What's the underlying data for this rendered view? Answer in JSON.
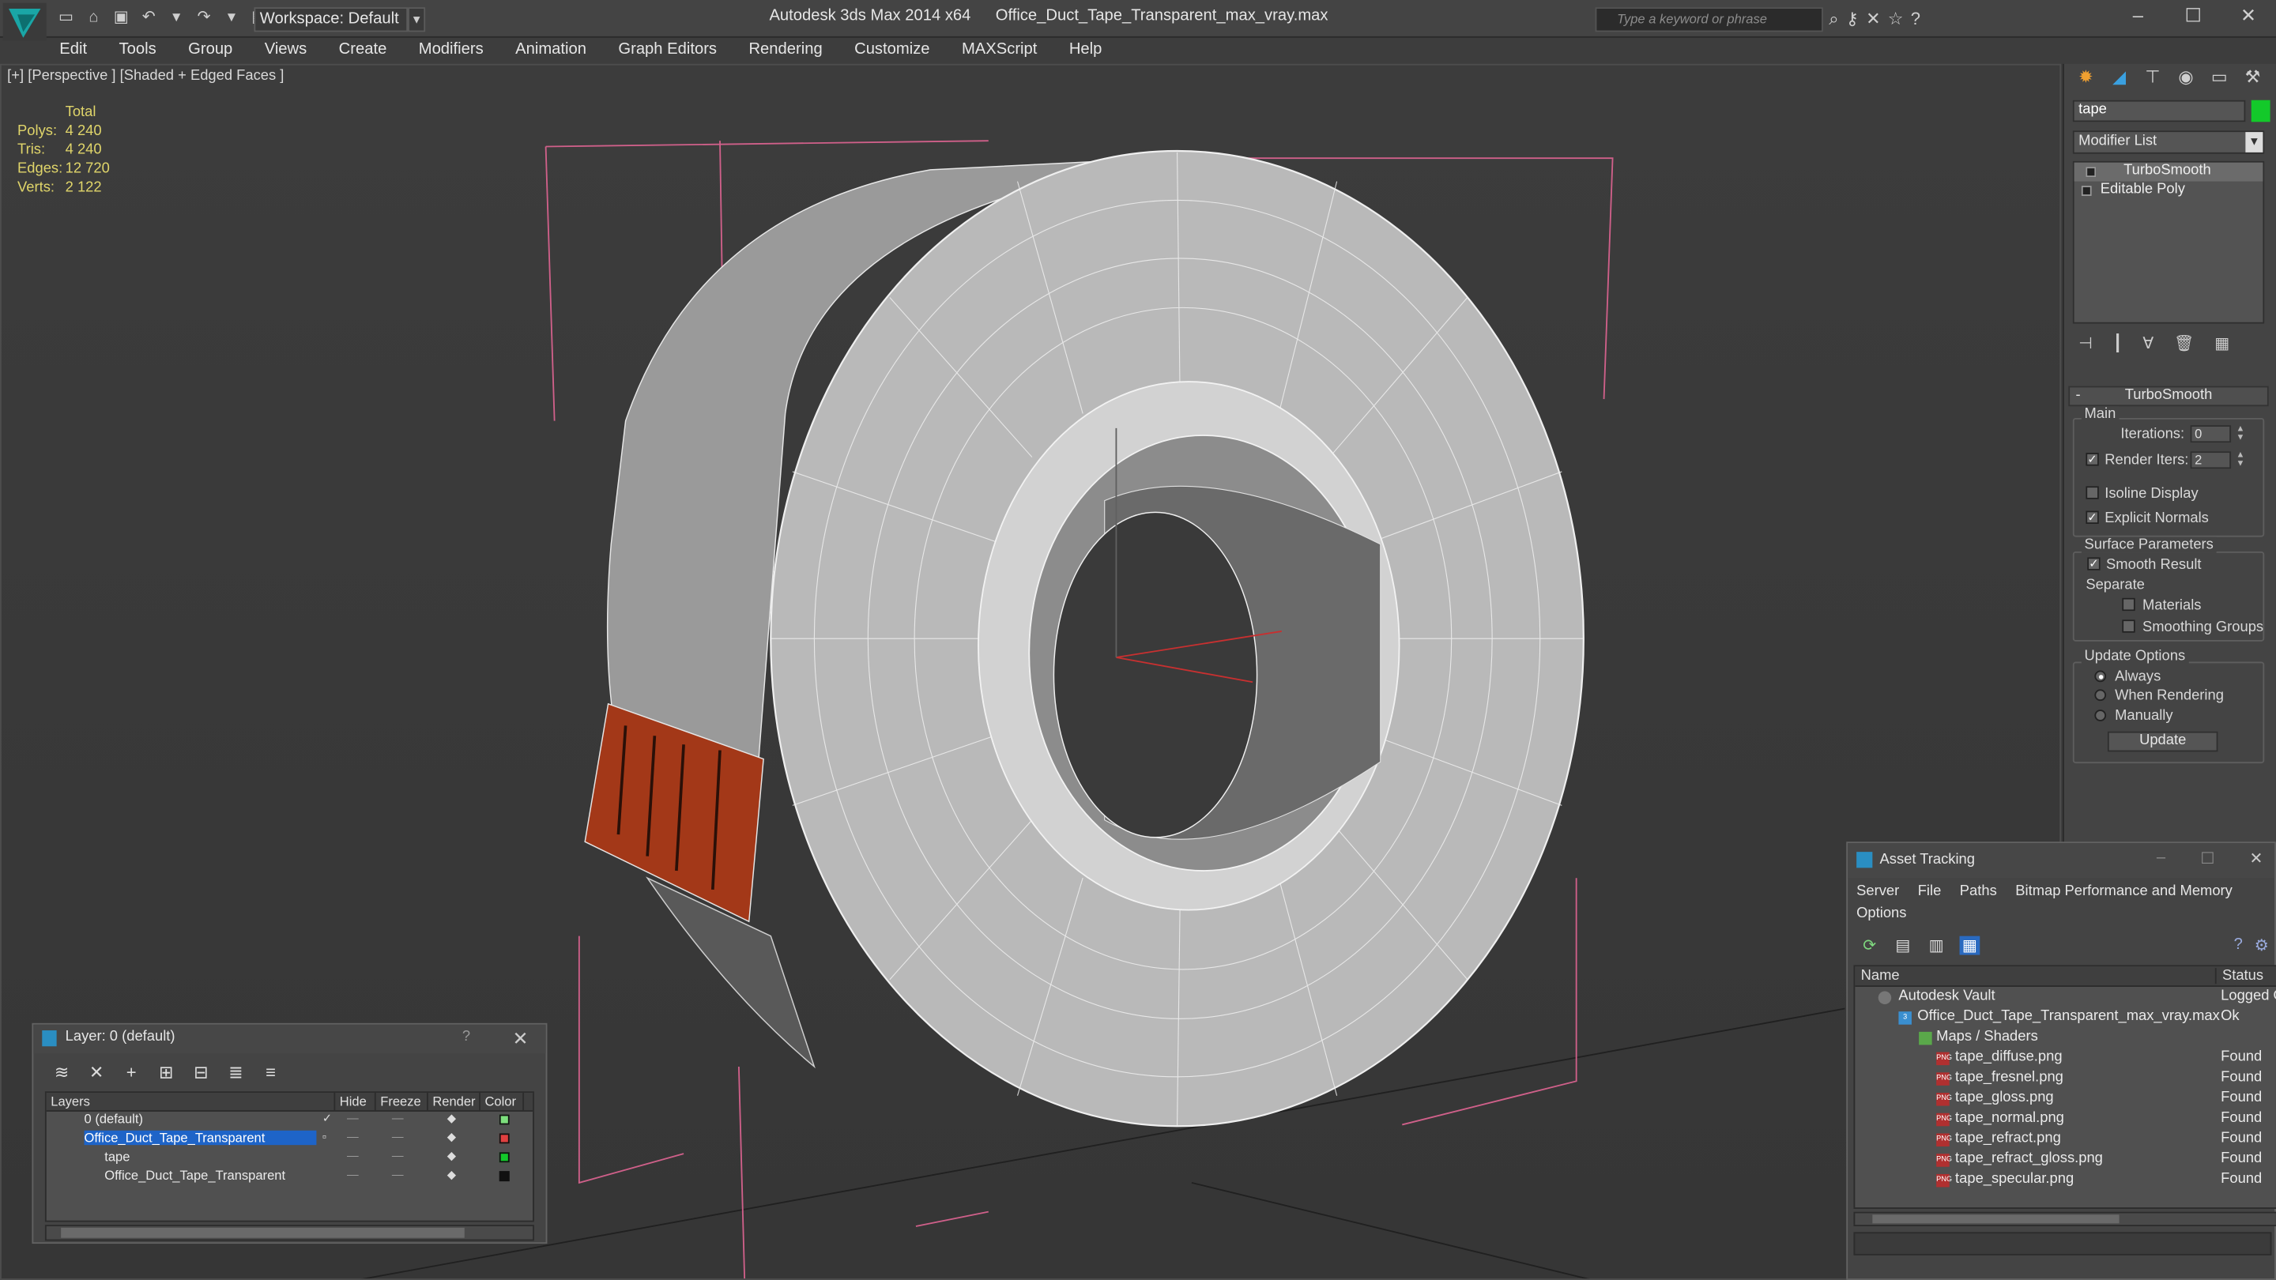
{
  "titlebar": {
    "workspace": "Workspace: Default",
    "app": "Autodesk 3ds Max  2014 x64",
    "file": "Office_Duct_Tape_Transparent_max_vray.max",
    "search_placeholder": "Type a keyword or phrase"
  },
  "menu": [
    "Edit",
    "Tools",
    "Group",
    "Views",
    "Create",
    "Modifiers",
    "Animation",
    "Graph Editors",
    "Rendering",
    "Customize",
    "MAXScript",
    "Help"
  ],
  "viewport": {
    "label": "[+] [Perspective ] [Shaded + Edged Faces ]",
    "stats": {
      "header": "Total",
      "rows": [
        {
          "k": "Polys:",
          "v": "4 240"
        },
        {
          "k": "Tris:",
          "v": "4 240"
        },
        {
          "k": "Edges:",
          "v": "12 720"
        },
        {
          "k": "Verts:",
          "v": "2 122"
        }
      ]
    }
  },
  "command_panel": {
    "object_name": "tape",
    "object_color": "#13c92a",
    "modifier_list": "Modifier List",
    "stack": [
      "TurboSmooth",
      "Editable Poly"
    ],
    "turbosmooth": {
      "title": "TurboSmooth",
      "main": "Main",
      "iterations_label": "Iterations:",
      "iterations": "0",
      "render_iters_label": "Render Iters:",
      "render_iters": "2",
      "isoline": "Isoline Display",
      "explicit_normals": "Explicit Normals",
      "surface_params": "Surface Parameters",
      "smooth_result": "Smooth Result",
      "separate": "Separate",
      "materials": "Materials",
      "smoothing_groups": "Smoothing Groups",
      "update_options": "Update Options",
      "always": "Always",
      "when_rendering": "When Rendering",
      "manually": "Manually",
      "update": "Update"
    }
  },
  "layer_window": {
    "title": "Layer: 0 (default)",
    "help": "?",
    "columns": [
      "Layers",
      "Hide",
      "Freeze",
      "Render",
      "Color"
    ],
    "rows": [
      {
        "name": "0 (default)",
        "color": "#7ddf7d"
      },
      {
        "name": "Office_Duct_Tape_Transparent",
        "color": "#e04040"
      },
      {
        "name": "tape",
        "color": "#13c92a"
      },
      {
        "name": "Office_Duct_Tape_Transparent",
        "color": "#111111"
      }
    ]
  },
  "asset_tracking": {
    "title": "Asset Tracking",
    "menu": [
      "Server",
      "File",
      "Paths",
      "Bitmap Performance and Memory",
      "Options"
    ],
    "columns": [
      "Name",
      "Status"
    ],
    "rows": [
      {
        "name": "Autodesk Vault",
        "status": "Logged O"
      },
      {
        "name": "Office_Duct_Tape_Transparent_max_vray.max",
        "status": "Ok"
      },
      {
        "name": "Maps / Shaders",
        "status": ""
      },
      {
        "name": "tape_diffuse.png",
        "status": "Found"
      },
      {
        "name": "tape_fresnel.png",
        "status": "Found"
      },
      {
        "name": "tape_gloss.png",
        "status": "Found"
      },
      {
        "name": "tape_normal.png",
        "status": "Found"
      },
      {
        "name": "tape_refract.png",
        "status": "Found"
      },
      {
        "name": "tape_refract_gloss.png",
        "status": "Found"
      },
      {
        "name": "tape_specular.png",
        "status": "Found"
      }
    ]
  }
}
